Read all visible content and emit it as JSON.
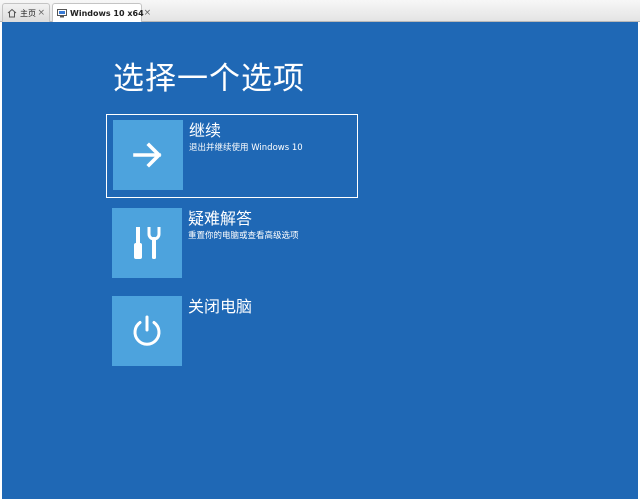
{
  "tabs": [
    {
      "label": "主页",
      "icon": "home-icon",
      "active": false
    },
    {
      "label": "Windows 10 x64",
      "icon": "vm-icon",
      "active": true
    }
  ],
  "tab_close_glyph": "×",
  "page": {
    "title": "选择一个选项",
    "background": "#1f68b5",
    "tile_color": "#4da3dd"
  },
  "options": [
    {
      "title": "继续",
      "desc": "退出并继续使用 Windows 10",
      "icon": "arrow-right-icon",
      "selected": true
    },
    {
      "title": "疑难解答",
      "desc": "重置你的电脑或查看高级选项",
      "icon": "tools-icon",
      "selected": false
    },
    {
      "title": "关闭电脑",
      "desc": "",
      "icon": "power-icon",
      "selected": false
    }
  ]
}
